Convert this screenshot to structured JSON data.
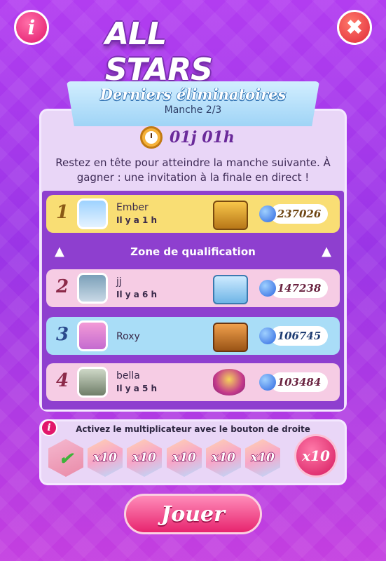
{
  "header": {
    "info_glyph": "i",
    "close_glyph": "✖",
    "logo_text": "ALL STARS"
  },
  "banner": {
    "title": "Derniers éliminatoires",
    "subtitle": "Manche 2/3"
  },
  "timer": {
    "value": "01j 01h"
  },
  "description": "Restez en tête pour atteindre la manche suivante. À gagner : une invitation à la finale en direct !",
  "zone_label": "Zone de qualification",
  "zone_chevron": "▲",
  "leaderboard": [
    {
      "rank": "1",
      "name": "Ember",
      "time": "Il y a 1 h",
      "score": "237026",
      "reward": "gold-chest-icon",
      "avatar": "penguin-avatar-icon",
      "bg": "#f9de74",
      "rank_color": "#8a5a15",
      "score_color": "#6d4512"
    },
    {
      "rank": "2",
      "name": "jj",
      "time": "Il y a 6 h",
      "score": "147238",
      "reward": "blue-chest-icon",
      "avatar": "pirate-avatar-icon",
      "bg": "#f6cce4",
      "rank_color": "#8c2a4a",
      "score_color": "#6a2340"
    },
    {
      "rank": "3",
      "name": "Roxy",
      "time": "",
      "score": "106745",
      "reward": "bronze-chest-icon",
      "avatar": "owl-avatar-icon",
      "bg": "#a9ddf7",
      "rank_color": "#2a4a8c",
      "score_color": "#1e3c72"
    },
    {
      "rank": "4",
      "name": "bella",
      "time": "Il y a 5 h",
      "score": "103484",
      "reward": "cake-icon",
      "avatar": "cat-avatar-icon",
      "bg": "#f6cce4",
      "rank_color": "#8c2a4a",
      "score_color": "#6a2340"
    }
  ],
  "multiplier": {
    "info_glyph": "i",
    "text": "Activez le multiplicateur avec le bouton de droite",
    "check_glyph": "✔",
    "slots": [
      "x10",
      "x10",
      "x10",
      "x10",
      "x10"
    ],
    "button_label": "x10"
  },
  "play_button": "Jouer",
  "colors": {
    "gold": "#f9de74",
    "pink": "#f6cce4",
    "blue": "#a9ddf7",
    "purple": "#8e3fcf"
  }
}
